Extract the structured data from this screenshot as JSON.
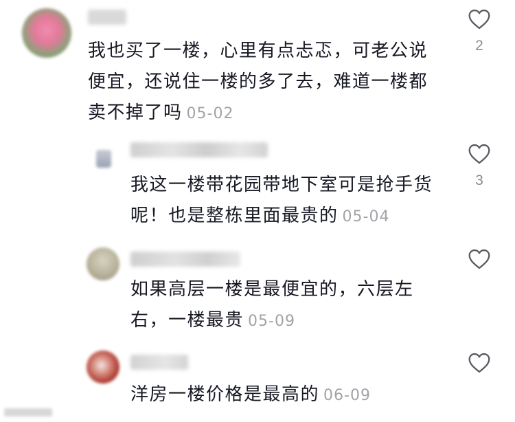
{
  "comments": [
    {
      "text": "我也买了一楼，心里有点忐忑，可老公说便宜，还说住一楼的多了去，难道一楼都卖不掉了吗",
      "date": "05-02",
      "likes": "2"
    },
    {
      "text": "我这一楼带花园带地下室可是抢手货呢！也是整栋里面最贵的",
      "date": "05-04",
      "likes": "3"
    },
    {
      "text": "如果高层一楼是最便宜的，六层左右，一楼最贵",
      "date": "05-09",
      "likes": ""
    },
    {
      "text": "洋房一楼价格是最高的",
      "date": "06-09",
      "likes": ""
    }
  ],
  "colors": {
    "text": "#161823",
    "date": "#a2a3a7",
    "icon": "#5a5b63"
  },
  "icons": {
    "like": "heart-outline-icon"
  }
}
